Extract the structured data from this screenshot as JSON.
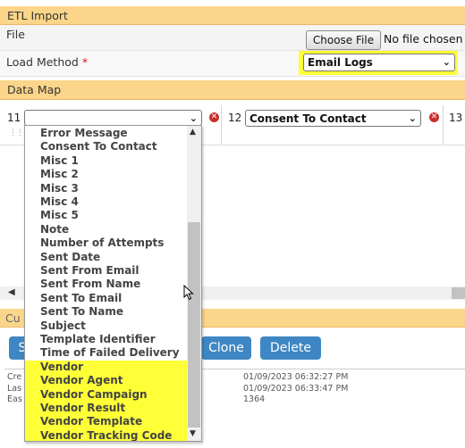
{
  "etl_import": {
    "title": "ETL Import",
    "file_label": "File",
    "choose_file_button": "Choose File",
    "no_file_text": "No file chosen",
    "load_method_label": "Load Method",
    "required_marker": "*",
    "load_method_value": "Email Logs"
  },
  "data_map": {
    "title": "Data Map",
    "columns": [
      {
        "number": "11",
        "value": ""
      },
      {
        "number": "12",
        "value": "Consent To Contact"
      },
      {
        "number": "13",
        "value": ""
      }
    ],
    "dropdown_options": [
      {
        "label": "Error Message",
        "highlighted": false
      },
      {
        "label": "Consent To Contact",
        "highlighted": false
      },
      {
        "label": "Misc 1",
        "highlighted": false
      },
      {
        "label": "Misc 2",
        "highlighted": false
      },
      {
        "label": "Misc 3",
        "highlighted": false
      },
      {
        "label": "Misc 4",
        "highlighted": false
      },
      {
        "label": "Misc 5",
        "highlighted": false
      },
      {
        "label": "Note",
        "highlighted": false
      },
      {
        "label": "Number of Attempts",
        "highlighted": false
      },
      {
        "label": "Sent Date",
        "highlighted": false
      },
      {
        "label": "Sent From Email",
        "highlighted": false
      },
      {
        "label": "Sent From Name",
        "highlighted": false
      },
      {
        "label": "Sent To Email",
        "highlighted": false
      },
      {
        "label": "Sent To Name",
        "highlighted": false
      },
      {
        "label": "Subject",
        "highlighted": false
      },
      {
        "label": "Template Identifier",
        "highlighted": false
      },
      {
        "label": "Time of Failed Delivery",
        "highlighted": false
      },
      {
        "label": "Vendor",
        "highlighted": true
      },
      {
        "label": "Vendor Agent",
        "highlighted": true
      },
      {
        "label": "Vendor Campaign",
        "highlighted": true
      },
      {
        "label": "Vendor Result",
        "highlighted": true
      },
      {
        "label": "Vendor Template",
        "highlighted": true
      },
      {
        "label": "Vendor Tracking Code",
        "highlighted": true
      }
    ]
  },
  "lower_section": {
    "title_partial": "Cu",
    "buttons": {
      "first_partial": "S",
      "clone": "Clone",
      "delete": "Delete"
    },
    "meta_labels": [
      "Cre",
      "Las",
      "Eas"
    ],
    "meta_values": [
      "01/09/2023 06:32:27 PM",
      "01/09/2023 06:33:47 PM",
      "1364"
    ]
  },
  "colors": {
    "section_header": "#fbd68a",
    "highlight": "#ffff37",
    "button": "#3f87c4",
    "remove_icon": "#c9302c"
  },
  "icons": [
    "chevron-down-icon",
    "remove-icon",
    "drag-handle-icon",
    "scroll-up-arrow-icon",
    "scroll-down-arrow-icon",
    "scroll-left-arrow-icon",
    "mouse-pointer-icon"
  ]
}
